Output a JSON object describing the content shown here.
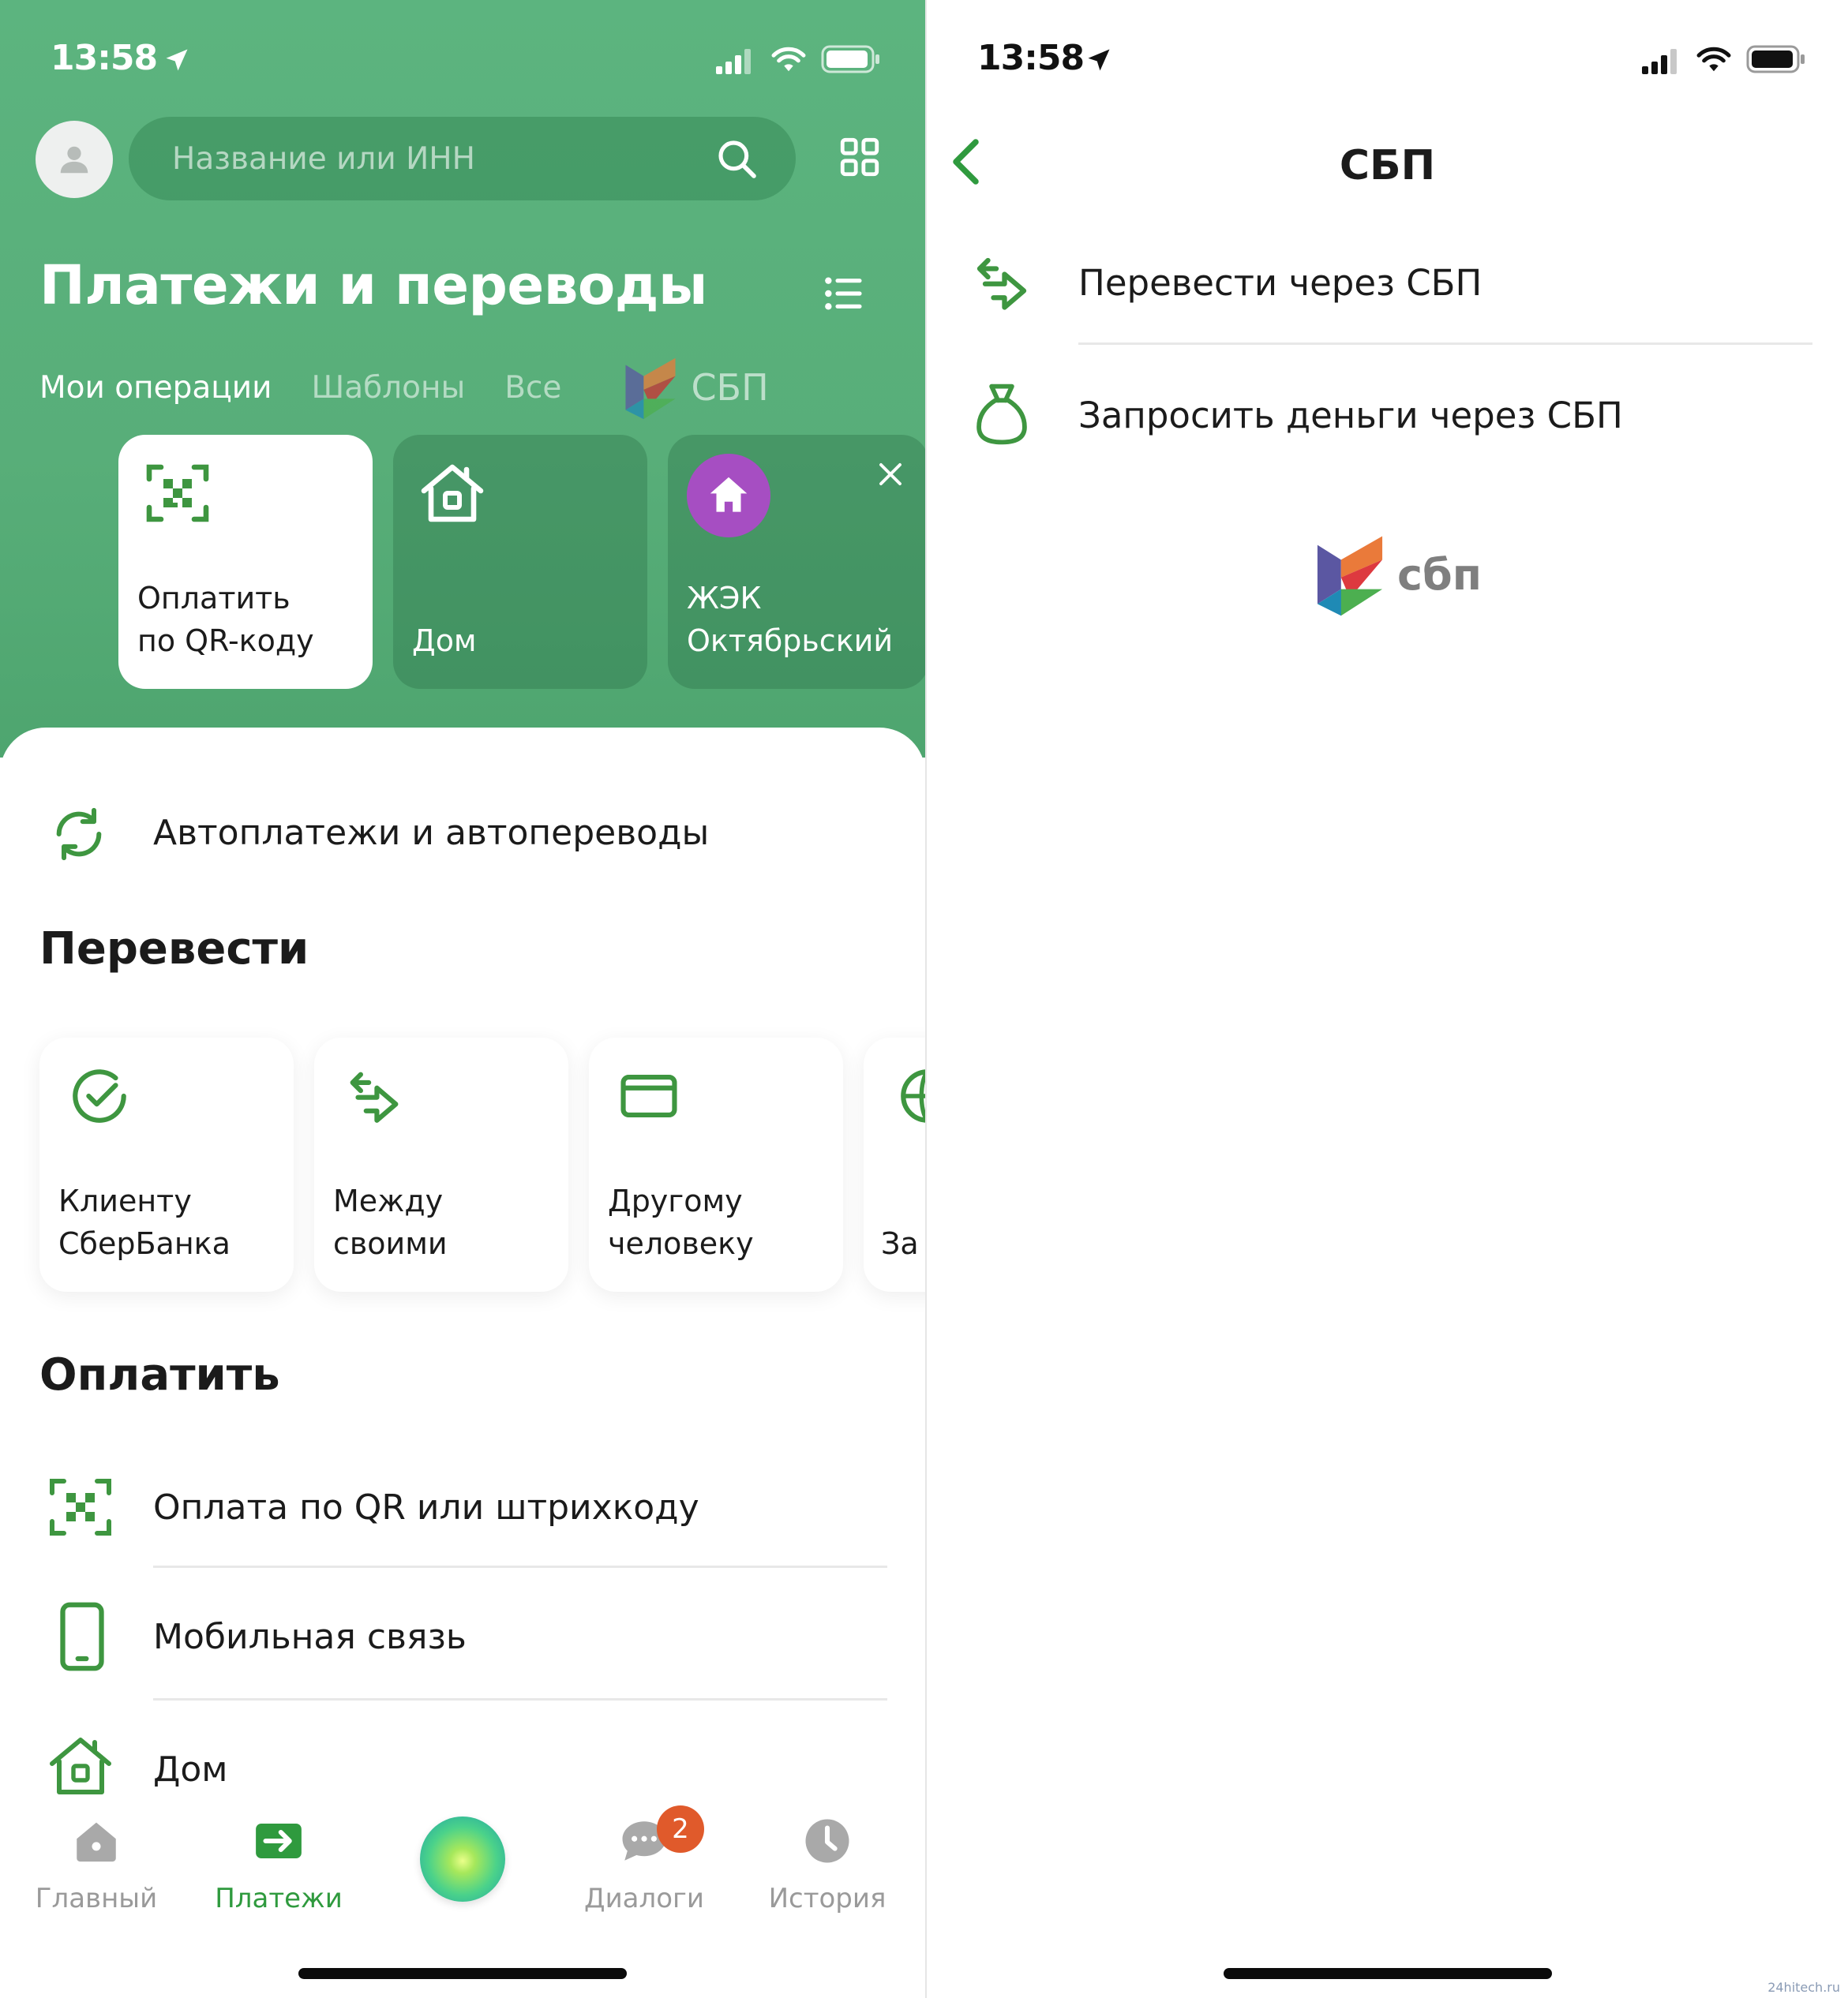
{
  "status_bar": {
    "time": "13:58"
  },
  "left": {
    "search": {
      "placeholder": "Название или ИНН"
    },
    "title": "Платежи и переводы",
    "tabs": [
      "Мои операции",
      "Шаблоны",
      "Все"
    ],
    "sbp_logo_text": "СБП",
    "cards": [
      {
        "label": "Оплатить\nпо QR-коду",
        "icon": "qr-code-icon"
      },
      {
        "label": "Дом",
        "icon": "house-icon"
      },
      {
        "label": "ЖЭК\nОктябрьский",
        "icon": "house-badge-icon"
      }
    ],
    "autopay_label": "Автоплатежи и автопереводы",
    "transfer_heading": "Перевести",
    "transfer_cards": [
      {
        "label": "Клиенту\nСберБанка",
        "icon": "check-circle-icon"
      },
      {
        "label": "Между\nсвоими",
        "icon": "swap-arrows-icon"
      },
      {
        "label": "Другому\nчеловеку",
        "icon": "card-icon"
      },
      {
        "label": "За",
        "icon": "globe-icon"
      }
    ],
    "pay_heading": "Оплатить",
    "pay_items": [
      {
        "label": "Оплата по QR или штрихкоду",
        "icon": "qr-scan-icon"
      },
      {
        "label": "Мобильная связь",
        "icon": "phone-icon"
      },
      {
        "label": "Дом",
        "icon": "house-icon"
      }
    ],
    "tabbar": {
      "items": [
        {
          "label": "Главный",
          "icon": "home-icon"
        },
        {
          "label": "Платежи",
          "icon": "payments-icon",
          "active": true
        },
        {
          "label": "",
          "icon": "assistant-orb"
        },
        {
          "label": "Диалоги",
          "icon": "chat-icon",
          "badge": "2"
        },
        {
          "label": "История",
          "icon": "clock-icon"
        }
      ]
    }
  },
  "right": {
    "title": "СБП",
    "items": [
      {
        "label": "Перевести через СБП",
        "icon": "swap-arrows-icon"
      },
      {
        "label": "Запросить деньги через СБП",
        "icon": "money-bag-icon"
      }
    ],
    "logo_text": "сбп"
  },
  "watermark": "24hitech.ru",
  "colors": {
    "accent": "#3e9640",
    "header_green": "#58ae79",
    "badge": "#e05a2b",
    "inactive_tab": "#9a9a9a"
  }
}
